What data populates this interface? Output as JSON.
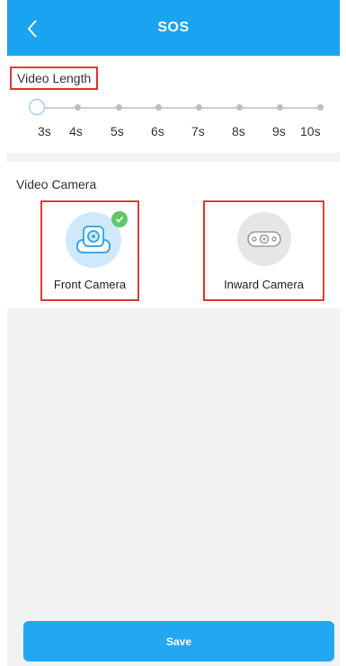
{
  "header": {
    "title": "SOS",
    "back_icon": "chevron-left-icon"
  },
  "video_length": {
    "label": "Video Length",
    "options": [
      "3s",
      "4s",
      "5s",
      "6s",
      "7s",
      "8s",
      "9s",
      "10s"
    ],
    "selected": "3s"
  },
  "video_camera": {
    "label": "Video Camera",
    "front": {
      "label": "Front Camera",
      "icon": "front-camera-icon",
      "selected": true
    },
    "inward": {
      "label": "Inward Camera",
      "icon": "inward-camera-icon",
      "selected": false
    }
  },
  "footer": {
    "save_label": "Save"
  },
  "colors": {
    "brand": "#1aa3f0",
    "highlight": "#e53935",
    "check": "#5fc66a"
  }
}
